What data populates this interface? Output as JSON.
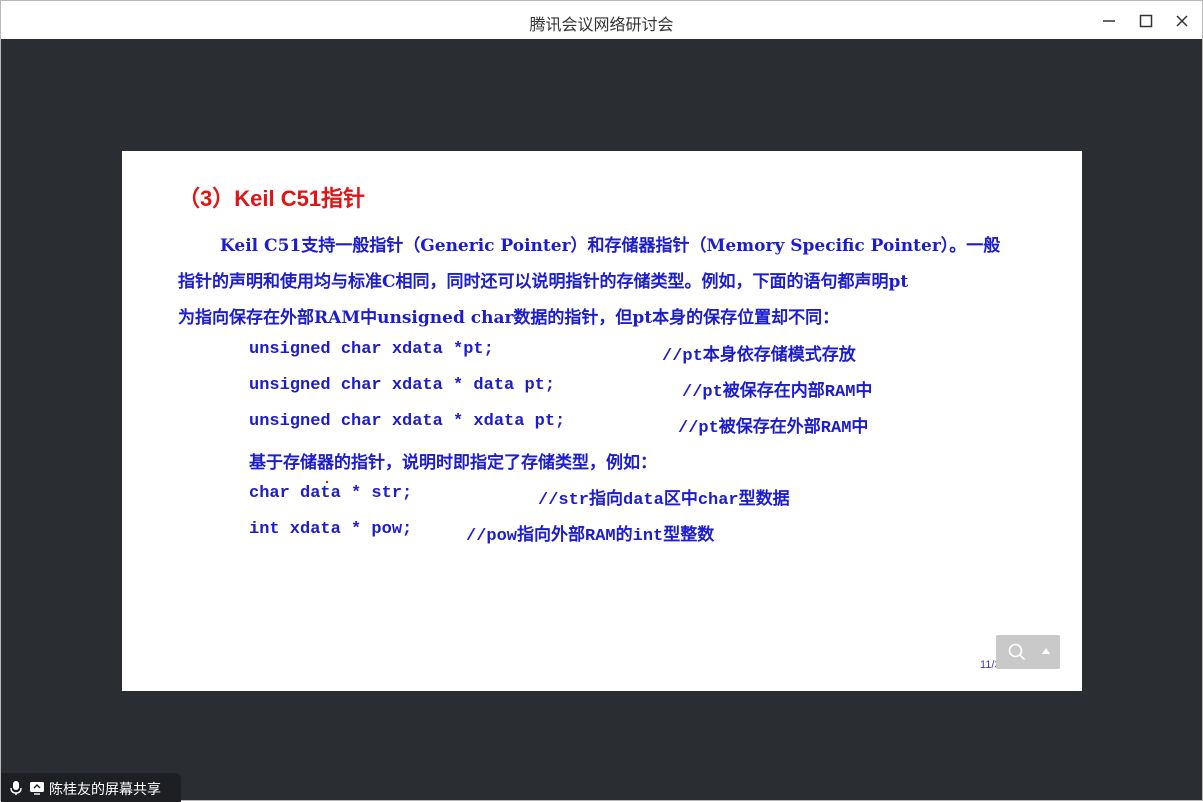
{
  "window": {
    "title": "腾讯会议网络研讨会",
    "controls": [
      "minimize-icon",
      "maximize-icon",
      "close-icon"
    ]
  },
  "slide": {
    "heading": "（3）Keil C51指针",
    "paragraph": [
      "Keil C51支持一般指针（Generic Pointer）和存储器指针（Memory Specific Pointer）。一般",
      "指针的声明和使用均与标准C相同，同时还可以说明指针的存储类型。例如，下面的语句都声明pt",
      "为指向保存在外部RAM中unsigned char数据的指针，但pt本身的保存位置却不同："
    ],
    "code_lines": [
      {
        "code": "unsigned char xdata *pt;",
        "comment": "//pt本身依存储模式存放"
      },
      {
        "code": "unsigned char xdata * data pt;",
        "comment": "//pt被保存在内部RAM中"
      },
      {
        "code": "unsigned char xdata * xdata pt;",
        "comment": "//pt被保存在外部RAM中"
      }
    ],
    "note": "基于存储器的指针，说明时即指定了存储类型，例如：",
    "code_lines2": [
      {
        "code": "char data * str;",
        "comment": "//str指向data区中char型数据"
      },
      {
        "code": "int xdata * pow;",
        "comment": "//pow指向外部RAM的int型整数"
      }
    ],
    "page_number": "11/30"
  },
  "share_bar": {
    "label": "陈桂友的屏幕共享"
  },
  "colors": {
    "heading": "#e01414",
    "body_text": "#1c1cd0",
    "stage_bg": "#2a2d31"
  }
}
